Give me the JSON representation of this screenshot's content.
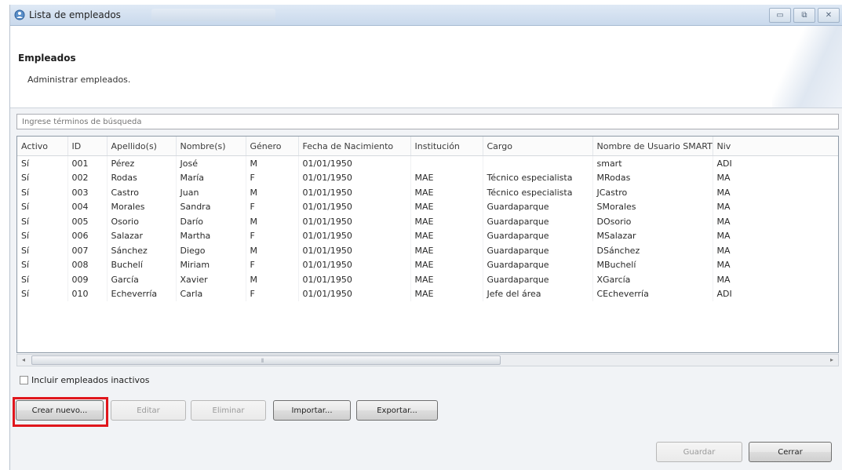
{
  "window": {
    "title": "Lista de empleados",
    "controls": [
      "▭",
      "⧉",
      "✕"
    ]
  },
  "header": {
    "title": "Empleados",
    "subtitle": "Administrar empleados."
  },
  "search": {
    "placeholder": "Ingrese términos de búsqueda"
  },
  "table": {
    "columns": [
      "Activo",
      "ID",
      "Apellido(s)",
      "Nombre(s)",
      "Género",
      "Fecha de Nacimiento",
      "Institución",
      "Cargo",
      "Nombre de Usuario SMART",
      "Niv"
    ],
    "rows": [
      [
        "Sí",
        "001",
        "Pérez",
        "José",
        "M",
        "01/01/1950",
        "",
        "",
        "smart",
        "ADI"
      ],
      [
        "Sí",
        "002",
        "Rodas",
        "María",
        "F",
        "01/01/1950",
        "MAE",
        "Técnico especialista",
        "MRodas",
        "MA"
      ],
      [
        "Sí",
        "003",
        "Castro",
        "Juan",
        "M",
        "01/01/1950",
        "MAE",
        "Técnico especialista",
        "JCastro",
        "MA"
      ],
      [
        "Sí",
        "004",
        "Morales",
        "Sandra",
        "F",
        "01/01/1950",
        "MAE",
        "Guardaparque",
        "SMorales",
        "MA"
      ],
      [
        "Sí",
        "005",
        "Osorio",
        "Darío",
        "M",
        "01/01/1950",
        "MAE",
        "Guardaparque",
        "DOsorio",
        "MA"
      ],
      [
        "Sí",
        "006",
        "Salazar",
        "Martha",
        "F",
        "01/01/1950",
        "MAE",
        "Guardaparque",
        "MSalazar",
        "MA"
      ],
      [
        "Sí",
        "007",
        "Sánchez",
        "Diego",
        "M",
        "01/01/1950",
        "MAE",
        "Guardaparque",
        "DSánchez",
        "MA"
      ],
      [
        "Sí",
        "008",
        "Buchelí",
        "Miriam",
        "F",
        "01/01/1950",
        "MAE",
        "Guardaparque",
        "MBuchelí",
        "MA"
      ],
      [
        "Sí",
        "009",
        "García",
        "Xavier",
        "M",
        "01/01/1950",
        "MAE",
        "Guardaparque",
        "XGarcía",
        "MA"
      ],
      [
        "Sí",
        "010",
        "Echeverría",
        "Carla",
        "F",
        "01/01/1950",
        "MAE",
        "Jefe del área",
        "CEcheverría",
        "ADI"
      ]
    ]
  },
  "scrollbar": {
    "left": "◂",
    "right": "▸",
    "grip": "⦀"
  },
  "checkbox": {
    "label": "Incluir empleados inactivos"
  },
  "buttons": {
    "create": "Crear nuevo...",
    "edit": "Editar",
    "delete": "Eliminar",
    "import": "Importar...",
    "export": "Exportar...",
    "save": "Guardar",
    "close": "Cerrar"
  },
  "colors": {
    "highlight": "#e0161c",
    "titlebar": "#c9d9ec"
  }
}
